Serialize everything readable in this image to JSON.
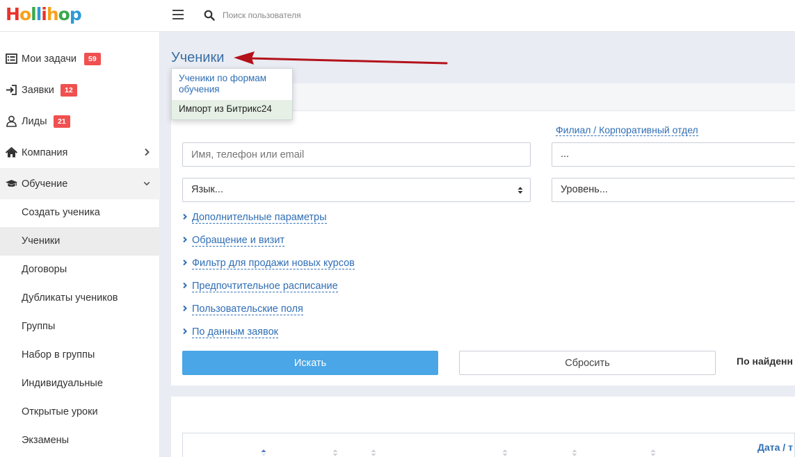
{
  "app": {
    "logo_letters": [
      "H",
      "o",
      "l",
      "l",
      "i",
      "h",
      "o",
      "p"
    ],
    "logo_colors": [
      "#e8332a",
      "#f7a21b",
      "#3aa84b",
      "#2d9ad7",
      "#e8332a",
      "#f7a21b",
      "#3aa84b",
      "#2d9ad7"
    ]
  },
  "topbar": {
    "search_placeholder": "Поиск пользователя"
  },
  "sidebar": {
    "items": [
      {
        "label": "Мои задачи",
        "badge": "59",
        "icon": "list-icon"
      },
      {
        "label": "Заявки",
        "badge": "12",
        "icon": "sign-in-icon"
      },
      {
        "label": "Лиды",
        "badge": "21",
        "icon": "user-icon"
      },
      {
        "label": "Компания",
        "icon": "home-icon"
      },
      {
        "label": "Обучение",
        "icon": "graduation-cap-icon"
      }
    ],
    "subitems": [
      "Создать ученика",
      "Ученики",
      "Договоры",
      "Дубликаты учеников",
      "Группы",
      "Набор в группы",
      "Индивидуальные",
      "Открытые уроки",
      "Экзамены"
    ],
    "active_subitem": "Ученики"
  },
  "main": {
    "title": "Ученики",
    "dropdown": {
      "item1": "Ученики по формам обучения",
      "item2": "Импорт из Битрикс24"
    },
    "branch_link": "Филиал / Корпоративный отдел",
    "name_placeholder": "Имя, телефон или email",
    "branch_value": "...",
    "language_value": "Язык...",
    "level_value": "Уровень...",
    "filters": [
      "Дополнительные параметры",
      "Обращение и визит",
      "Фильтр для продажи новых курсов",
      "Предпочтительное расписание",
      "Пользовательские поля",
      "По данным заявок"
    ],
    "search_button": "Искать",
    "reset_button": "Сбросить",
    "found_text": "По найденн",
    "table_date_header": "Дата / т"
  },
  "colors": {
    "accent_blue": "#4aa6e6",
    "link_blue": "#2f6eb5",
    "badge_red": "#f0504f",
    "annotation_arrow": "#b3121b"
  }
}
